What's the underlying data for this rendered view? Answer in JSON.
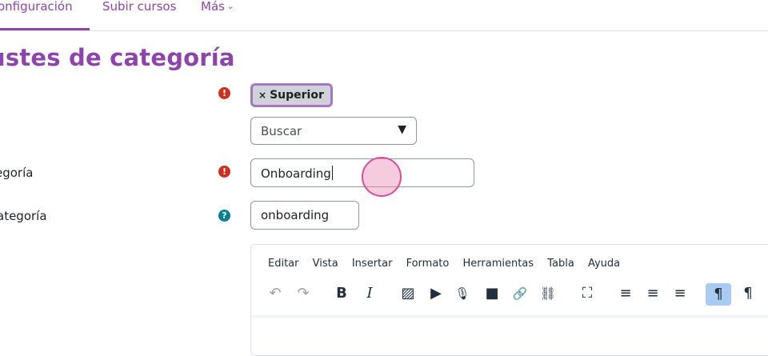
{
  "nav": {
    "items": [
      {
        "label": "onfiguración"
      },
      {
        "label": "Subir cursos"
      },
      {
        "label": "Más"
      }
    ]
  },
  "page": {
    "title": "ustes de categoría"
  },
  "form": {
    "parent_chip": {
      "remove": "×",
      "label": "Superior"
    },
    "parent_search": {
      "value": "Buscar"
    },
    "name_label": "egoría",
    "name_value": "Onboarding",
    "idnumber_label": "ategoría",
    "idnumber_value": "onboarding",
    "required_icon": "!",
    "help_icon": "?"
  },
  "editor": {
    "menu": [
      "Editar",
      "Vista",
      "Insertar",
      "Formato",
      "Herramientas",
      "Tabla",
      "Ayuda"
    ],
    "toolbar": [
      {
        "name": "undo-icon",
        "glyph": "↶"
      },
      {
        "name": "redo-icon",
        "glyph": "↷"
      },
      {
        "name": "bold-icon",
        "glyph": "B"
      },
      {
        "name": "italic-icon",
        "glyph": "I"
      },
      {
        "name": "image-icon",
        "glyph": "▨"
      },
      {
        "name": "media-icon",
        "glyph": "▶"
      },
      {
        "name": "microphone-icon",
        "glyph": "🎙"
      },
      {
        "name": "video-icon",
        "glyph": "■"
      },
      {
        "name": "link-icon",
        "glyph": "🔗"
      },
      {
        "name": "unlink-icon",
        "glyph": "⛓"
      },
      {
        "name": "fullscreen-icon",
        "glyph": "⛶"
      },
      {
        "name": "align-left-icon",
        "glyph": "≡"
      },
      {
        "name": "align-center-icon",
        "glyph": "≡"
      },
      {
        "name": "align-right-icon",
        "glyph": "≡"
      },
      {
        "name": "ltr-icon",
        "glyph": "¶"
      },
      {
        "name": "rtl-icon",
        "glyph": "¶"
      }
    ]
  },
  "colors": {
    "accent": "#8e44ad",
    "required": "#ca3120",
    "help": "#008196",
    "chip_border": "#a576c4"
  }
}
